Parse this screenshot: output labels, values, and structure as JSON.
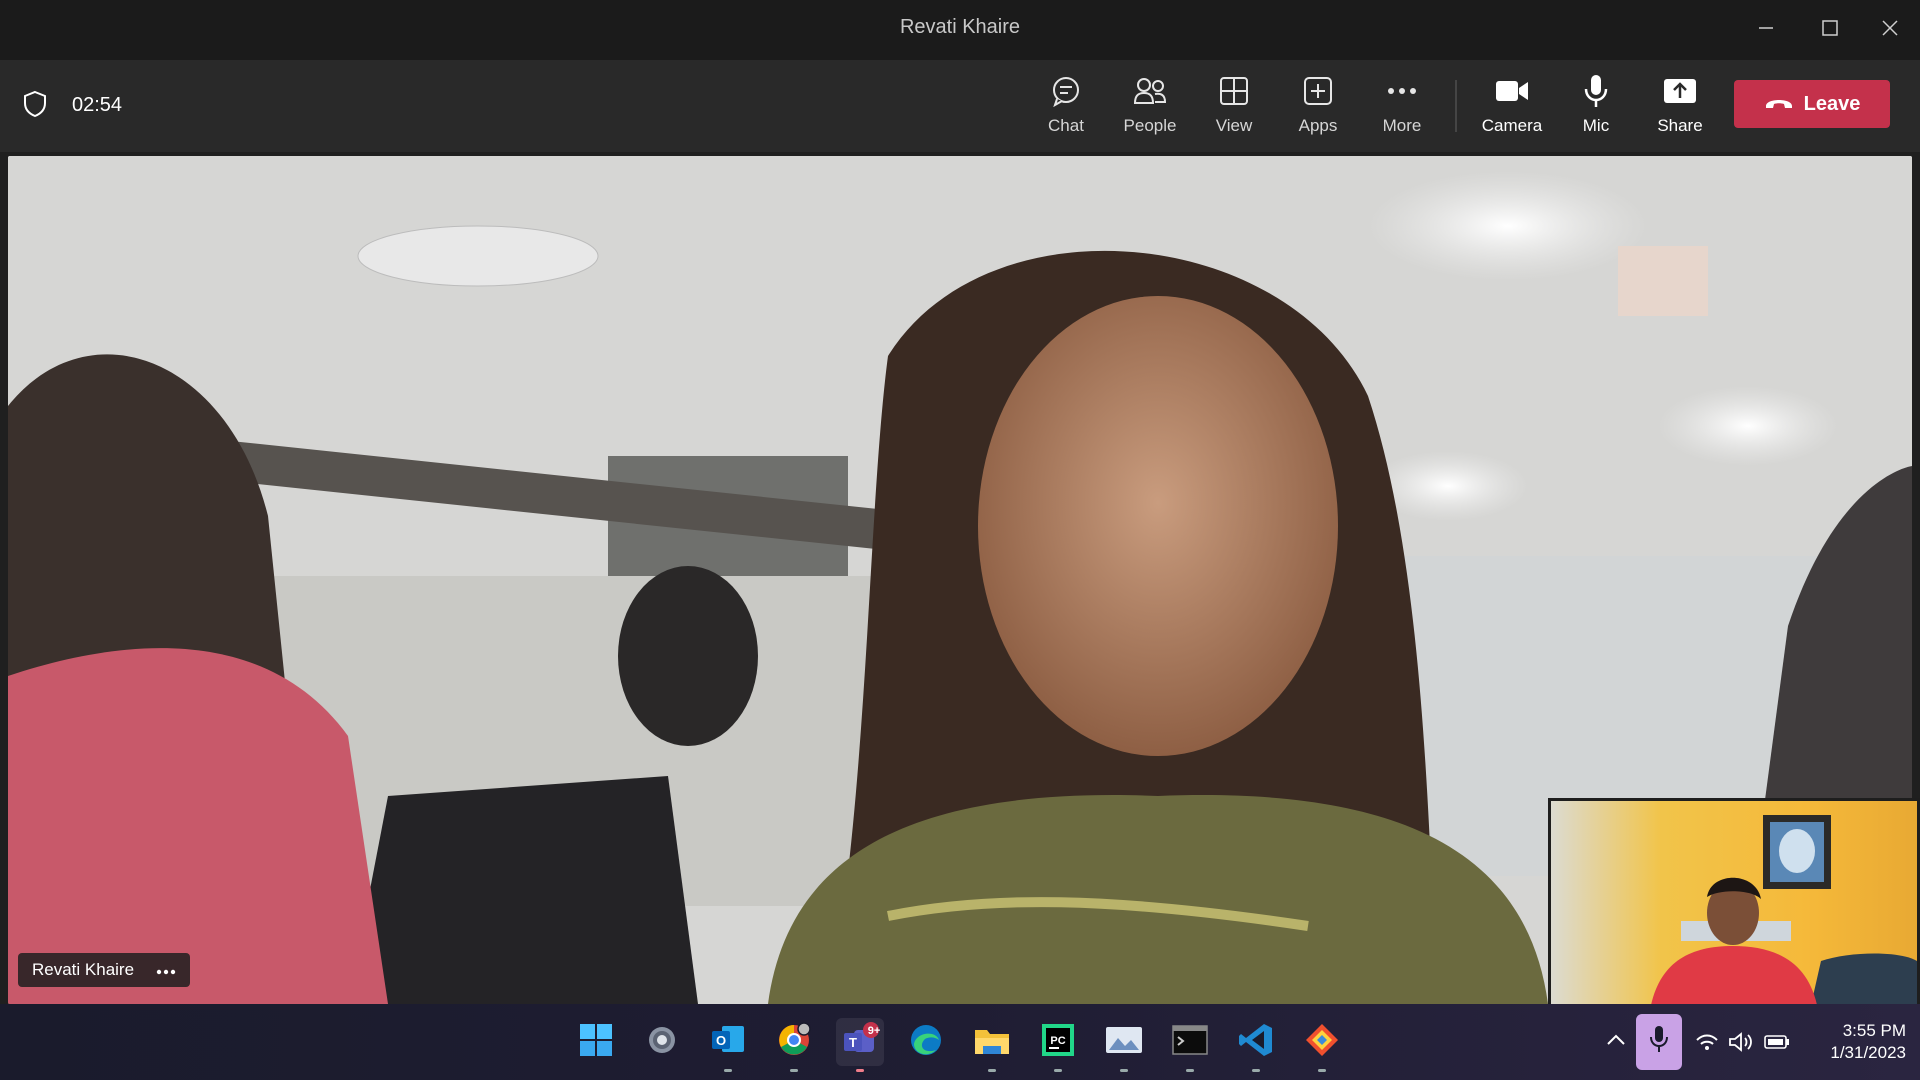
{
  "window": {
    "title": "Revati Khaire"
  },
  "meeting": {
    "timer": "02:54"
  },
  "toolbar": {
    "chat": "Chat",
    "people": "People",
    "view": "View",
    "apps": "Apps",
    "more": "More",
    "camera": "Camera",
    "mic": "Mic",
    "share": "Share",
    "leave": "Leave"
  },
  "participant": {
    "name": "Revati Khaire"
  },
  "taskbar": {
    "teams_badge": "9+",
    "time": "3:55 PM",
    "date": "1/31/2023"
  },
  "colors": {
    "leave": "#c4314b",
    "titlebar": "#1b1b1b",
    "toolbar": "#292929"
  }
}
